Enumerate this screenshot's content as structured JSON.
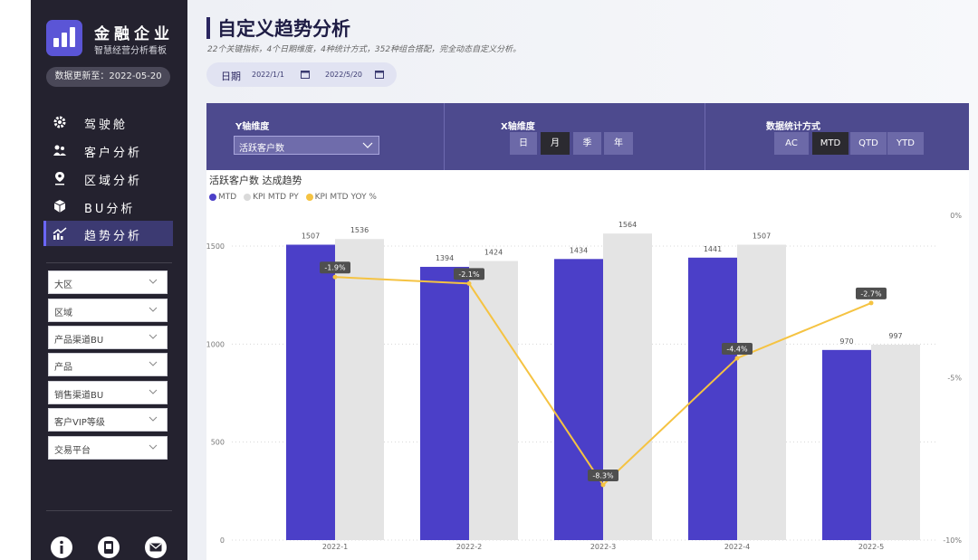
{
  "brand": {
    "name": "金融企业",
    "subtitle": "智慧经营分析看板",
    "update_text": "数据更新至：2022-05-20"
  },
  "nav": {
    "items": [
      {
        "label": "驾驶舱",
        "icon": "gear-icon"
      },
      {
        "label": "客户分析",
        "icon": "users-icon"
      },
      {
        "label": "区域分析",
        "icon": "location-pin-icon"
      },
      {
        "label": "BU分析",
        "icon": "cube-icon"
      },
      {
        "label": "趋势分析",
        "icon": "trend-chart-icon"
      }
    ],
    "active_index": 4
  },
  "filters": [
    "大区",
    "区域",
    "产品渠道BU",
    "产品",
    "销售渠道BU",
    "客户VIP等级",
    "交易平台"
  ],
  "sidebar_bottom_icons": [
    "info-icon",
    "app-icon",
    "mail-icon"
  ],
  "header": {
    "title": "自定义趋势分析",
    "subtitle": "22个关键指标，4个日期维度，4种统计方式，352种组合搭配，完全动态自定义分析。",
    "date_label": "日期",
    "date_start": "2022/1/1",
    "date_end": "2022/5/20"
  },
  "controls": {
    "y_axis": {
      "label": "Y轴维度",
      "selected": "活跃客户数"
    },
    "x_axis": {
      "label": "X轴维度",
      "options": [
        "日",
        "月",
        "季",
        "年"
      ],
      "selected": "月"
    },
    "stat": {
      "label": "数据统计方式",
      "options": [
        "AC",
        "MTD",
        "QTD",
        "YTD"
      ],
      "selected": "MTD"
    }
  },
  "colors": {
    "mtd": "#4b3fc8",
    "kpi": "#e4e4e4",
    "yoy": "#f5c342",
    "sidebar": "#24222f",
    "accent": "#4d4a8e"
  },
  "chart_data": {
    "type": "bar",
    "title": "活跃客户数 达成趋势",
    "categories": [
      "2022-1",
      "2022-2",
      "2022-3",
      "2022-4",
      "2022-5"
    ],
    "series": [
      {
        "name": "MTD",
        "kind": "bar",
        "values": [
          1507,
          1394,
          1434,
          1441,
          970
        ]
      },
      {
        "name": "KPI MTD PY",
        "kind": "bar",
        "values": [
          1536,
          1424,
          1564,
          1507,
          997
        ]
      },
      {
        "name": "KPI MTD YOY %",
        "kind": "line",
        "axis": "right",
        "values": [
          -1.9,
          -2.1,
          -8.3,
          -4.4,
          -2.7
        ]
      }
    ],
    "y_left": {
      "ticks": [
        0,
        500,
        1000,
        1500
      ],
      "range": [
        0,
        1650
      ]
    },
    "y_right": {
      "ticks": [
        "0%",
        "-5%",
        "-10%"
      ],
      "range": [
        -10,
        0
      ]
    },
    "legend_position": "top-left",
    "grid": true
  }
}
